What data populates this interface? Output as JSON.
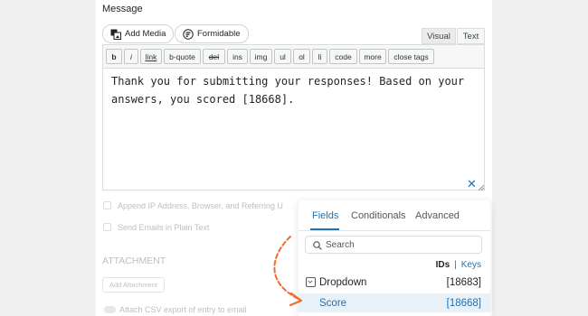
{
  "message_label": "Message",
  "media": {
    "add_media": "Add Media",
    "formidable": "Formidable"
  },
  "editor_tabs": {
    "visual": "Visual",
    "text": "Text"
  },
  "quicktags": [
    "b",
    "i",
    "link",
    "b-quote",
    "del",
    "ins",
    "img",
    "ul",
    "ol",
    "li",
    "code",
    "more",
    "close tags"
  ],
  "editor_content": "Thank you for submitting your responses! Based on your answers, you scored [18668].",
  "background_options": {
    "append_ip": "Append IP Address, Browser, and Referring U",
    "plain_text": "Send Emails in Plain Text",
    "attachment_heading": "ATTACHMENT",
    "add_attachment": "Add Attachment",
    "attach_csv": "Attach CSV export of entry to email"
  },
  "fields_panel": {
    "tabs": [
      "Fields",
      "Conditionals",
      "Advanced"
    ],
    "active_tab": "Fields",
    "search_placeholder": "Search",
    "ids_label": "IDs",
    "separator": "|",
    "keys_label": "Keys",
    "rows": [
      {
        "name": "Dropdown",
        "id": "[18683]"
      },
      {
        "name": "Score",
        "id": "[18668]"
      }
    ]
  },
  "colors": {
    "accent": "#2271b1",
    "arrow": "#ef6c2f",
    "highlight": "#e8f0f8"
  }
}
